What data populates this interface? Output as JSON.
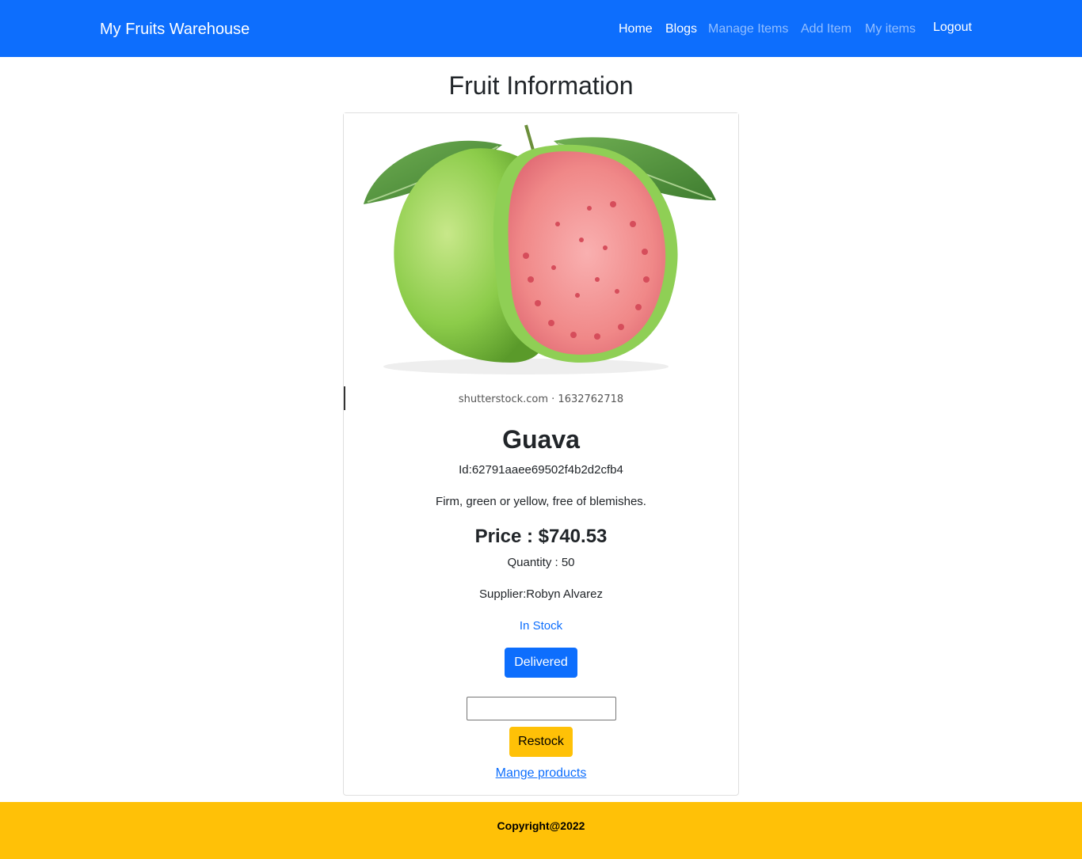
{
  "navbar": {
    "brand": "My Fruits Warehouse",
    "links": [
      "Home",
      "Blogs",
      "Manage Items",
      "Add Item",
      "My items",
      "Logout"
    ]
  },
  "page": {
    "title": "Fruit Information"
  },
  "card": {
    "image_caption": "shutterstock.com · 1632762718",
    "name": "Guava",
    "id_text": "Id:62791aaee69502f4b2d2cfb4",
    "description": "Firm, green or yellow, free of blemishes.",
    "price_text": "Price : $740.53",
    "quantity_text": "Quantity : 50",
    "supplier_text": "Supplier:Robyn Alvarez",
    "stock_status": "In Stock",
    "delivered_label": "Delivered",
    "restock_input_value": "",
    "restock_label": "Restock",
    "manage_link": "Mange products"
  },
  "footer": {
    "text": "Copyright@2022"
  },
  "colors": {
    "primary": "#0d6efd",
    "warning": "#ffc107",
    "text": "#212529"
  }
}
